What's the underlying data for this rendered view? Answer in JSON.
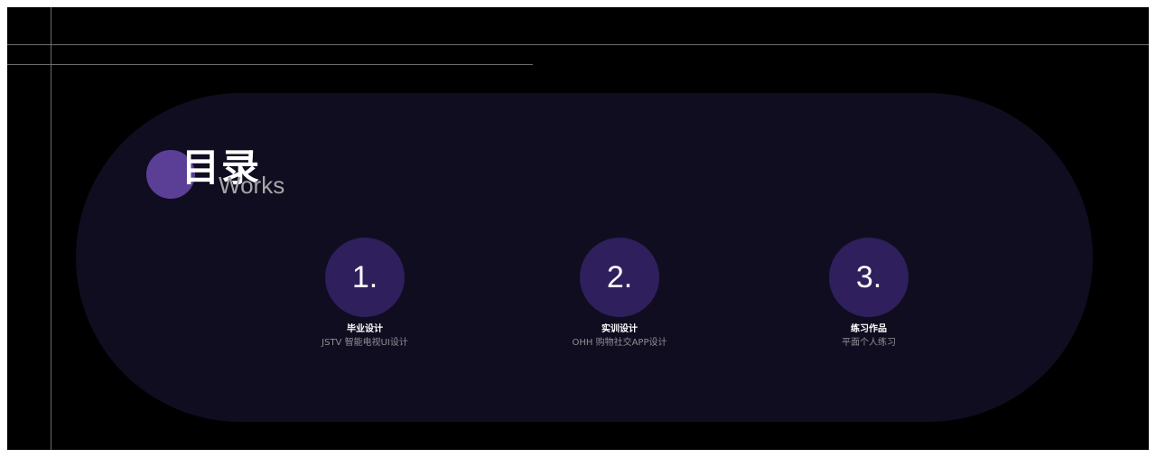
{
  "heading": {
    "title": "目录",
    "subtitle": "Works"
  },
  "items": [
    {
      "number": "1.",
      "title": "毕业设计",
      "subtitle": "JSTV 智能电视UI设计"
    },
    {
      "number": "2.",
      "title": "实训设计",
      "subtitle": "OHH 购物社交APP设计"
    },
    {
      "number": "3.",
      "title": "练习作品",
      "subtitle": "平面个人练习"
    }
  ],
  "colors": {
    "background": "#000000",
    "panel": "#100d20",
    "accent": "#5b3f97",
    "number_circle": "#2f1f5c",
    "guide_line": "#6e6e6e"
  }
}
